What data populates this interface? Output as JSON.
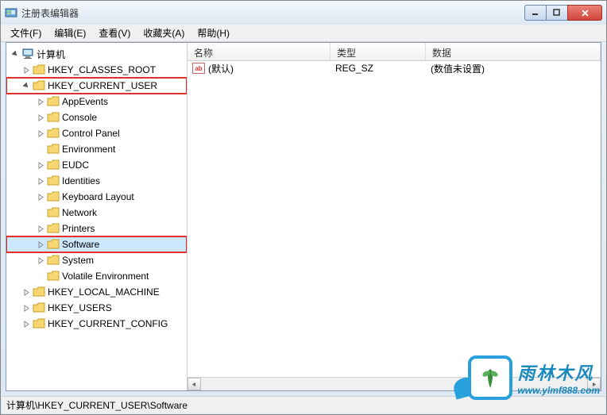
{
  "window": {
    "title": "注册表编辑器"
  },
  "menu": {
    "file": "文件(F)",
    "edit": "编辑(E)",
    "view": "查看(V)",
    "favorites": "收藏夹(A)",
    "help": "帮助(H)"
  },
  "tree": {
    "root": "计算机",
    "hkcr": "HKEY_CLASSES_ROOT",
    "hkcu": "HKEY_CURRENT_USER",
    "hkcu_children": {
      "appevents": "AppEvents",
      "console": "Console",
      "control_panel": "Control Panel",
      "environment": "Environment",
      "eudc": "EUDC",
      "identities": "Identities",
      "keyboard_layout": "Keyboard Layout",
      "network": "Network",
      "printers": "Printers",
      "software": "Software",
      "system": "System",
      "volatile_environment": "Volatile Environment"
    },
    "hklm": "HKEY_LOCAL_MACHINE",
    "hku": "HKEY_USERS",
    "hkcc": "HKEY_CURRENT_CONFIG"
  },
  "list": {
    "columns": {
      "name": "名称",
      "type": "类型",
      "data": "数据"
    },
    "row0": {
      "name": "(默认)",
      "type": "REG_SZ",
      "data": "(数值未设置)"
    }
  },
  "statusbar": {
    "path": "计算机\\HKEY_CURRENT_USER\\Software"
  },
  "watermark": {
    "title": "雨林木风",
    "url": "www.ylmf888.com"
  }
}
